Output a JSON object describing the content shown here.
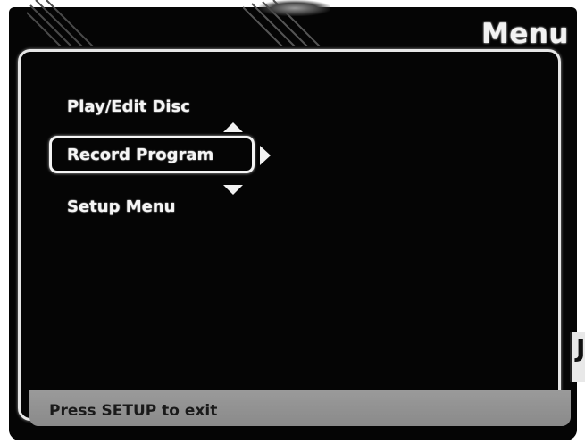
{
  "header": {
    "title": "Menu"
  },
  "menu": {
    "items": [
      {
        "label": "Play/Edit Disc",
        "selected": false
      },
      {
        "label": "Record Program",
        "selected": true
      },
      {
        "label": "Setup Menu",
        "selected": false
      }
    ]
  },
  "status_bar": {
    "text": "Press SETUP to exit"
  },
  "edge": {
    "glyph": "J"
  },
  "icons": {
    "up": "triangle-up-icon",
    "down": "triangle-down-icon",
    "right": "triangle-right-icon"
  },
  "colors": {
    "background": "#050505",
    "text": "#f5f5f5",
    "status_bar": "#929292",
    "status_text": "#1a1a1a"
  }
}
